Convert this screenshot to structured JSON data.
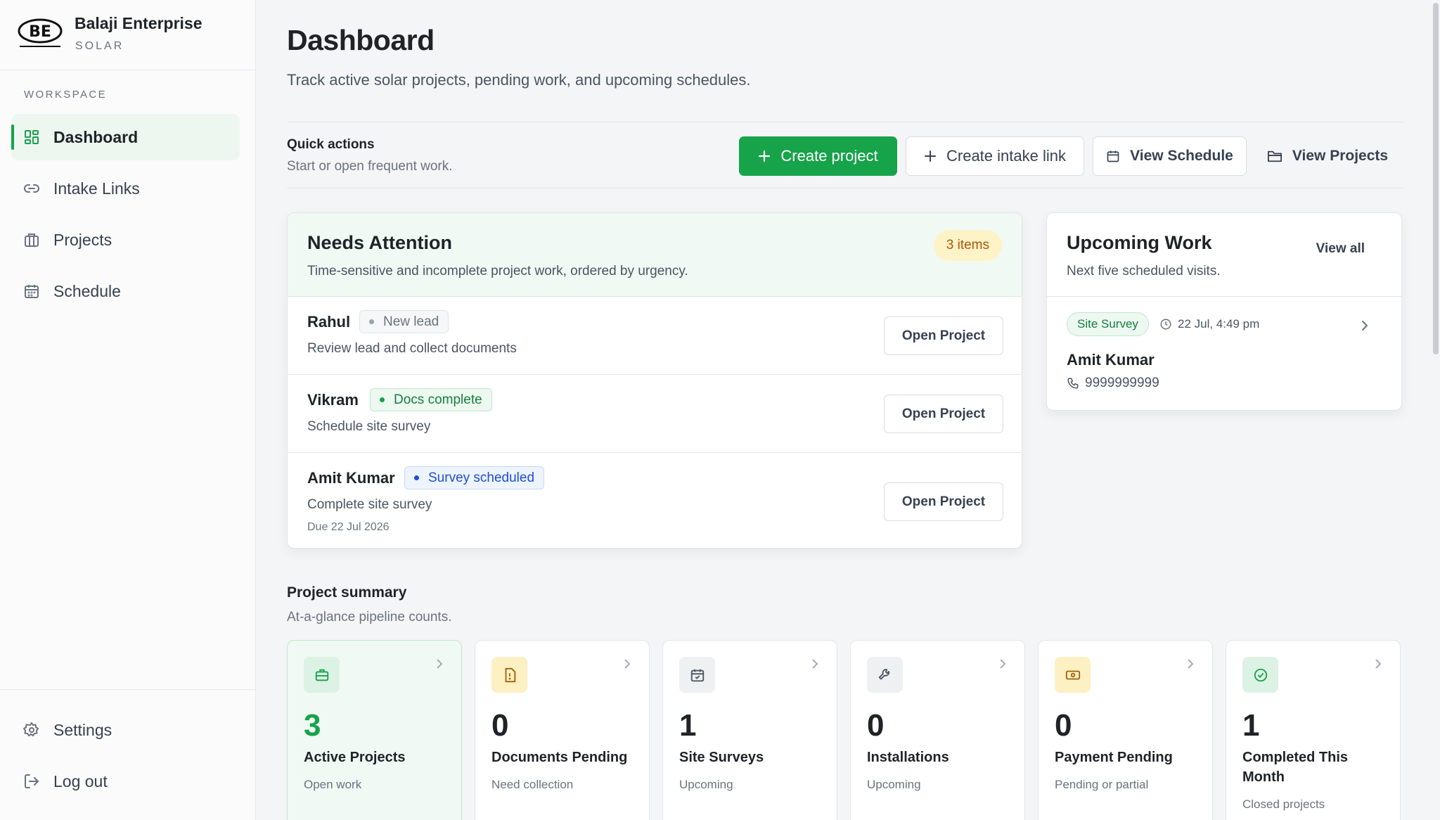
{
  "brand": {
    "name": "Balaji Enterprise",
    "sub": "SOLAR",
    "logo_text": "BE"
  },
  "sidebar": {
    "section_label": "WORKSPACE",
    "items": [
      {
        "label": "Dashboard",
        "icon": "grid-icon",
        "active": true
      },
      {
        "label": "Intake Links",
        "icon": "link-icon"
      },
      {
        "label": "Projects",
        "icon": "building-icon"
      },
      {
        "label": "Schedule",
        "icon": "calendar-icon"
      }
    ],
    "bottom": [
      {
        "label": "Settings",
        "icon": "gear-icon"
      },
      {
        "label": "Log out",
        "icon": "logout-icon"
      }
    ]
  },
  "header": {
    "title": "Dashboard",
    "subtitle": "Track active solar projects, pending work, and upcoming schedules."
  },
  "quick_actions": {
    "title": "Quick actions",
    "subtitle": "Start or open frequent work.",
    "create_project": "Create project",
    "create_intake": "Create intake link",
    "view_schedule": "View Schedule",
    "view_projects": "View Projects"
  },
  "attention": {
    "title": "Needs Attention",
    "subtitle": "Time-sensitive and incomplete project work, ordered by urgency.",
    "badge": "3 items",
    "open_label": "Open Project",
    "rows": [
      {
        "name": "Rahul",
        "status": "New lead",
        "task": "Review lead and collect documents",
        "due": ""
      },
      {
        "name": "Vikram",
        "status": "Docs complete",
        "task": "Schedule site survey",
        "due": ""
      },
      {
        "name": "Amit Kumar",
        "status": "Survey scheduled",
        "task": "Complete site survey",
        "due": "Due 22 Jul 2026"
      }
    ]
  },
  "upcoming": {
    "title": "Upcoming Work",
    "subtitle": "Next five scheduled visits.",
    "view_all": "View all",
    "item": {
      "type": "Site Survey",
      "time": "22 Jul, 4:49 pm",
      "name": "Amit Kumar",
      "phone": "9999999999"
    }
  },
  "summary": {
    "title": "Project summary",
    "subtitle": "At-a-glance pipeline counts.",
    "cards": [
      {
        "value": "3",
        "label": "Active Projects",
        "sub": "Open work",
        "icon": "briefcase-icon"
      },
      {
        "value": "0",
        "label": "Documents Pending",
        "sub": "Need collection",
        "icon": "document-alert-icon"
      },
      {
        "value": "1",
        "label": "Site Surveys",
        "sub": "Upcoming",
        "icon": "calendar-check-icon"
      },
      {
        "value": "0",
        "label": "Installations",
        "sub": "Upcoming",
        "icon": "wrench-icon"
      },
      {
        "value": "0",
        "label": "Payment Pending",
        "sub": "Pending or partial",
        "icon": "cash-icon"
      },
      {
        "value": "1",
        "label": "Completed This Month",
        "sub": "Closed projects",
        "icon": "check-circle-icon"
      }
    ]
  },
  "colors": {
    "accent": "#16a34a",
    "warning_bg": "#fef3c7",
    "info": "#1d4ed8"
  }
}
